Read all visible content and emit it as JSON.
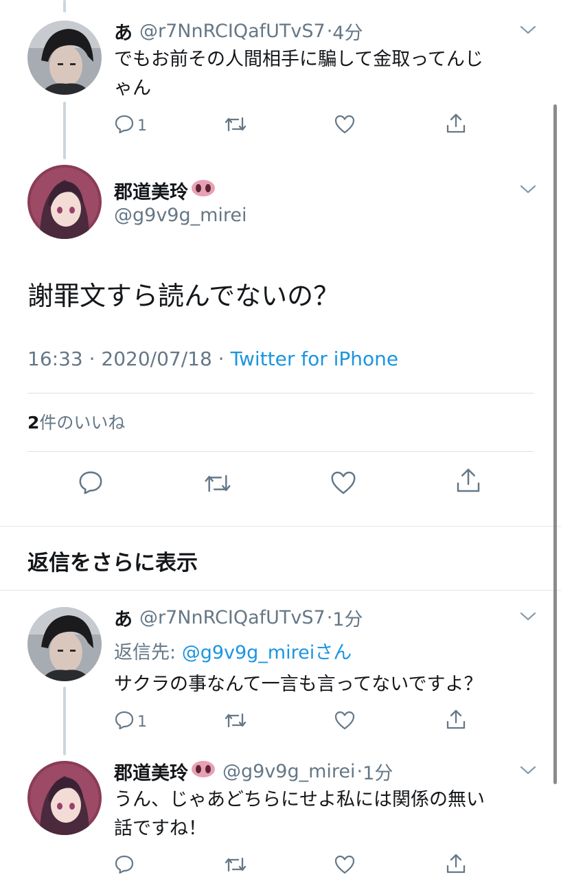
{
  "tweet1": {
    "name": "あ",
    "handle": "@r7NnRCIQafUTvS7",
    "time": "4分",
    "text_line1": "でもお前その人間相手に騙して金取ってんじ",
    "text_line2": "ゃん",
    "reply_count": "1"
  },
  "main": {
    "name": "郡道美玲",
    "handle": "@g9v9g_mirei",
    "text": "謝罪文すら読んでないの？",
    "time": "16:33 · 2020/07/18 · ",
    "source": "Twitter for iPhone",
    "likes_count": "2",
    "likes_label": "件のいいね"
  },
  "more_replies": "返信をさらに表示",
  "tweet2": {
    "name": "あ",
    "handle": "@r7NnRCIQafUTvS7",
    "time": "1分",
    "reply_to_label": "返信先: ",
    "reply_to_handle": "@g9v9g_mirei",
    "reply_to_suffix": "さん",
    "text": "サクラの事なんて一言も言ってないですよ？",
    "reply_count": "1"
  },
  "tweet3": {
    "name": "郡道美玲",
    "handle": "@g9v9g_mirei",
    "time": "1分",
    "text_line1": "うん、じゃあどちらにせよ私には関係の無い",
    "text_line2": "話ですね！"
  },
  "colors": {
    "link": "#1b95e0",
    "secondary": "#657786",
    "icon": "#657786",
    "divider": "#e1e8ed"
  }
}
